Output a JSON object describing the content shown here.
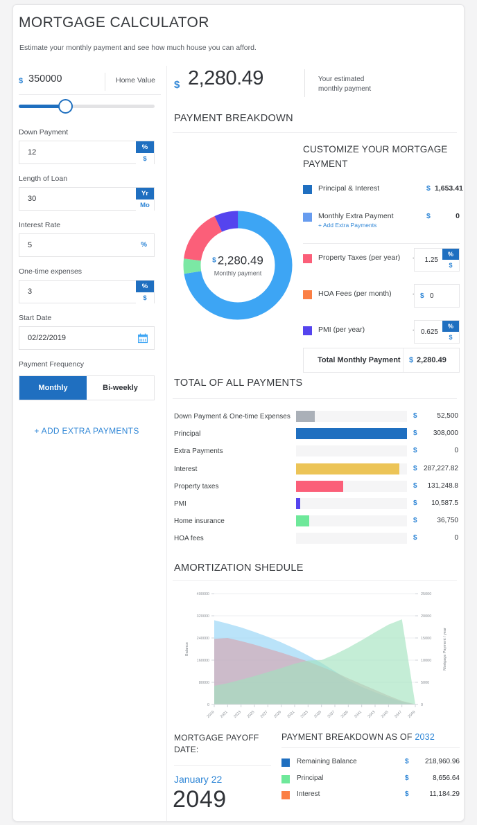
{
  "header": {
    "title": "MORTGAGE CALCULATOR",
    "subtitle": "Estimate your monthly payment and see how much house you can afford."
  },
  "sidebar": {
    "home_value": {
      "label": "Home Value",
      "currency": "$",
      "value": "350000",
      "slider_percent": 36
    },
    "fields": [
      {
        "label": "Down Payment",
        "value": "12",
        "unit_primary": "%",
        "unit_secondary": "$"
      },
      {
        "label": "Length of Loan",
        "value": "30",
        "unit_primary": "Yr",
        "unit_secondary": "Mo"
      },
      {
        "label": "Interest Rate",
        "value": "5",
        "unit_single": "%"
      },
      {
        "label": "One-time expenses",
        "value": "3",
        "unit_primary": "%",
        "unit_secondary": "$"
      },
      {
        "label": "Start Date",
        "value": "02/22/2019",
        "icon": "calendar-icon"
      }
    ],
    "payment_frequency": {
      "label": "Payment Frequency",
      "options": [
        "Monthly",
        "Bi-weekly"
      ],
      "selected": "Monthly"
    },
    "add_extra_payments": "+ ADD EXTRA PAYMENTS"
  },
  "estimate": {
    "currency": "$",
    "amount": "2,280.49",
    "note_line1": "Your estimated",
    "note_line2": "monthly payment"
  },
  "sections": {
    "payment_breakdown": "PAYMENT BREAKDOWN",
    "total_of_all_payments": "TOTAL OF ALL PAYMENTS",
    "amortization": "AMORTIZATION SHEDULE",
    "customize": "CUSTOMIZE YOUR MORTGAGE PAYMENT"
  },
  "donut": {
    "center_currency": "$",
    "center_amount": "2,280.49",
    "center_caption": "Monthly payment"
  },
  "customize_rows": [
    {
      "name": "Principal & Interest",
      "color": "#1f6fc0",
      "currency": "$",
      "value": "1,653.41",
      "type": "readonly"
    },
    {
      "name": "Monthly Extra Payment",
      "sub": "+ Add Extra Payments",
      "color": "#679cef",
      "currency": "$",
      "value": "0",
      "type": "readonly"
    },
    {
      "name": "Property Taxes (per year)",
      "color": "#fb5f79",
      "plus": "+",
      "input_value": "1.25",
      "unit_primary": "%",
      "unit_secondary": "$",
      "type": "input-unit"
    },
    {
      "name": "HOA Fees (per month)",
      "color": "#fb7f44",
      "plus": "+",
      "input_value": "0",
      "currency": "$",
      "type": "input-currency"
    },
    {
      "name": "PMI (per year)",
      "color": "#5544ee",
      "plus": "+",
      "input_value": "0.625",
      "unit_primary": "%",
      "unit_secondary": "$",
      "type": "input-unit"
    }
  ],
  "total_row": {
    "label": "Total Monthly Payment",
    "currency": "$",
    "value": "2,280.49"
  },
  "chart_data": [
    {
      "type": "pie",
      "title": "Payment Breakdown (donut)",
      "labels": [
        "Principal & Interest",
        "Property Taxes",
        "PMI",
        "Home insurance"
      ],
      "values": [
        1653.41,
        364.58,
        182.29,
        102.08
      ],
      "colors": [
        "#3da5f4",
        "#fb5f79",
        "#5544ee",
        "#7be8a4"
      ],
      "center_label": "$2,280.49 Monthly payment",
      "legend": "right"
    },
    {
      "type": "bar",
      "title": "TOTAL OF ALL PAYMENTS",
      "orientation": "horizontal",
      "categories": [
        "Down Payment & One-time Expenses",
        "Principal",
        "Extra Payments",
        "Interest",
        "Property taxes",
        "PMI",
        "Home insurance",
        "HOA fees"
      ],
      "values": [
        52500,
        308000,
        0,
        287227.82,
        131248.8,
        10587.5,
        36750,
        0
      ],
      "value_labels": [
        "52,500",
        "308,000",
        "0",
        "287,227.82",
        "131,248.8",
        "10,587.5",
        "36,750",
        "0"
      ],
      "colors": [
        "#aab0b8",
        "#1f6fc0",
        "#f5f5f6",
        "#ecc košice",
        "#fb5f79",
        "#5544ee",
        "#6ee89a",
        "#f5f5f6"
      ],
      "bar_colors": [
        "#aab0b8",
        "#1f6fc0",
        "#f5f5f6",
        "#ecc457",
        "#fb5f79",
        "#5544ee",
        "#6ee89a",
        "#f5f5f6"
      ],
      "max": 308000,
      "xlabel": "",
      "ylabel": "",
      "grid": false
    },
    {
      "type": "area",
      "title": "AMORTIZATION SHEDULE",
      "x": [
        2019,
        2021,
        2023,
        2025,
        2027,
        2029,
        2031,
        2033,
        2035,
        2037,
        2039,
        2041,
        2043,
        2045,
        2047,
        2049
      ],
      "y_left_label": "Balance",
      "y_left_ticks": [
        0,
        80000,
        160000,
        240000,
        320000,
        400000
      ],
      "y_left_range": [
        0,
        400000
      ],
      "y_right_label": "Mortgage Payment / year",
      "y_right_ticks": [
        0,
        5000,
        10000,
        15000,
        20000,
        25000
      ],
      "y_right_range": [
        0,
        25000
      ],
      "grid": true,
      "series": [
        {
          "name": "Balance",
          "axis": "left",
          "color": "#8fd2f5",
          "values": [
            304000,
            292000,
            278000,
            262000,
            244000,
            224000,
            202000,
            177000,
            150000,
            120000,
            87000,
            63000,
            44000,
            26000,
            10000,
            0
          ]
        },
        {
          "name": "Interest",
          "axis": "right",
          "color": "#d6a3ad",
          "values": [
            14800,
            15000,
            14300,
            13500,
            12600,
            11700,
            10700,
            9700,
            8500,
            7300,
            5900,
            4600,
            3300,
            2000,
            800,
            60
          ]
        },
        {
          "name": "Principal",
          "axis": "right",
          "color": "#9fe2bd",
          "values": [
            4200,
            4800,
            5600,
            6400,
            7300,
            8200,
            9200,
            9900,
            10000,
            11300,
            12800,
            14500,
            16300,
            18000,
            19200,
            0
          ]
        }
      ]
    }
  ],
  "totals": {
    "currency": "$"
  },
  "payoff": {
    "heading": "MORTGAGE PAYOFF DATE:",
    "month_day": "January 22",
    "year": "2049"
  },
  "payment_breakdown_as_of": {
    "heading_prefix": "PAYMENT BREAKDOWN AS OF",
    "year": "2032",
    "currency": "$",
    "rows": [
      {
        "name": "Remaining Balance",
        "color": "#1f6fc0",
        "value": "218,960.96"
      },
      {
        "name": "Principal",
        "color": "#6ee89a",
        "value": "8,656.64"
      },
      {
        "name": "Interest",
        "color": "#fb7f44",
        "value": "11,184.29"
      }
    ]
  }
}
